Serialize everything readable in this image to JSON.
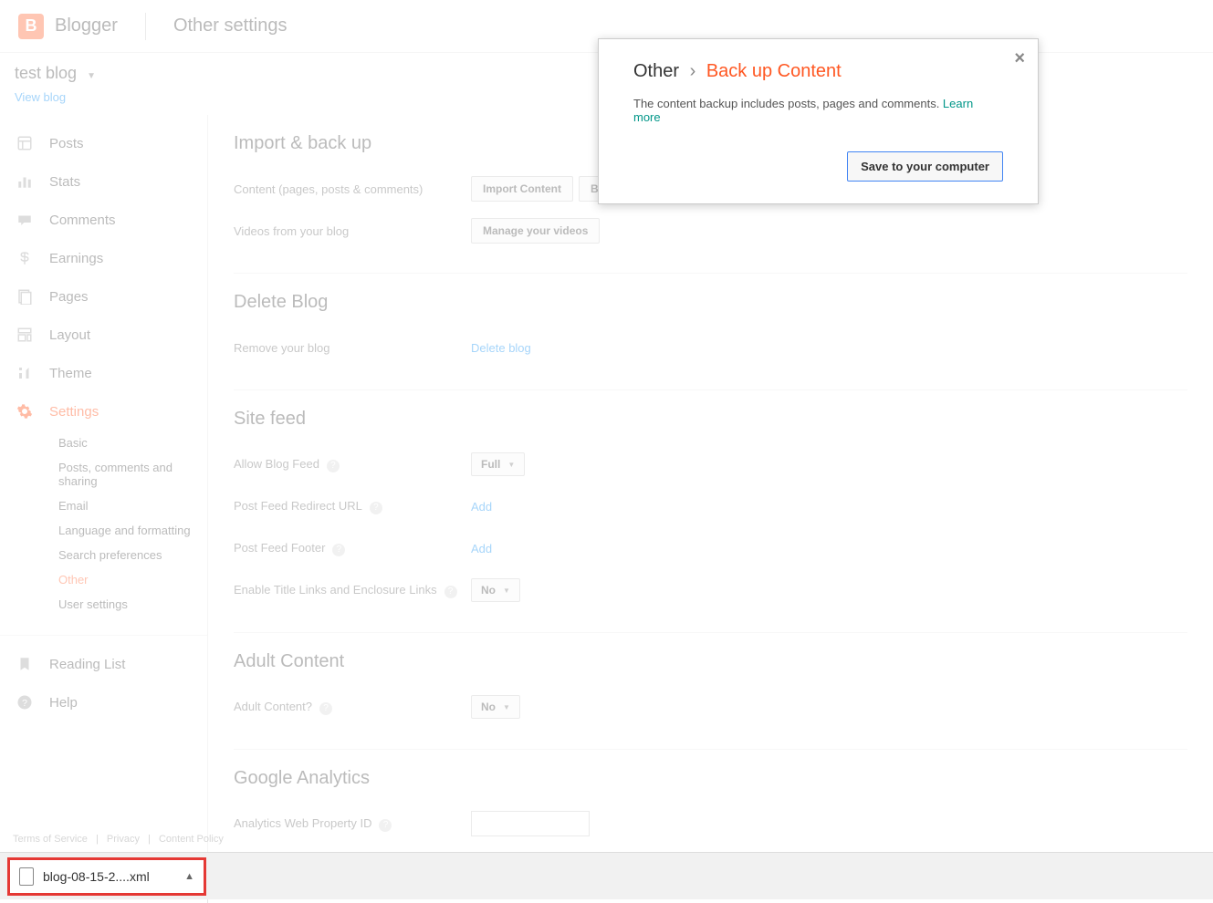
{
  "header": {
    "brand": "Blogger",
    "logo_letter": "B",
    "page_title": "Other settings"
  },
  "blog_selector": {
    "name": "test blog",
    "view_link": "View blog"
  },
  "nav": {
    "items": [
      {
        "label": "Posts",
        "icon": "posts"
      },
      {
        "label": "Stats",
        "icon": "stats"
      },
      {
        "label": "Comments",
        "icon": "comments"
      },
      {
        "label": "Earnings",
        "icon": "earnings"
      },
      {
        "label": "Pages",
        "icon": "pages"
      },
      {
        "label": "Layout",
        "icon": "layout"
      },
      {
        "label": "Theme",
        "icon": "theme"
      },
      {
        "label": "Settings",
        "icon": "settings",
        "active": true
      }
    ],
    "settings_sub": [
      "Basic",
      "Posts, comments and sharing",
      "Email",
      "Language and formatting",
      "Search preferences",
      "Other",
      "User settings"
    ],
    "bottom": [
      {
        "label": "Reading List",
        "icon": "bookmark"
      },
      {
        "label": "Help",
        "icon": "help"
      }
    ]
  },
  "sections": {
    "import": {
      "title": "Import & back up",
      "content_label": "Content (pages, posts & comments)",
      "import_btn": "Import Content",
      "backup_btn": "Back up Content",
      "videos_label": "Videos from your blog",
      "manage_videos_btn": "Manage your videos"
    },
    "delete": {
      "title": "Delete Blog",
      "remove_label": "Remove your blog",
      "delete_link": "Delete blog"
    },
    "feed": {
      "title": "Site feed",
      "allow_label": "Allow Blog Feed",
      "allow_value": "Full",
      "redirect_label": "Post Feed Redirect URL",
      "redirect_link": "Add",
      "footer_label": "Post Feed Footer",
      "footer_link": "Add",
      "enclosure_label": "Enable Title Links and Enclosure Links",
      "enclosure_value": "No"
    },
    "adult": {
      "title": "Adult Content",
      "label": "Adult Content?",
      "value": "No"
    },
    "analytics": {
      "title": "Google Analytics",
      "label": "Analytics Web Property ID"
    }
  },
  "modal": {
    "crumb_other": "Other",
    "crumb_sep": "›",
    "crumb_current": "Back up Content",
    "description": "The content backup includes posts, pages and comments. ",
    "learn_more": "Learn more",
    "save_btn": "Save to your computer"
  },
  "footer": {
    "terms": "Terms of Service",
    "privacy": "Privacy",
    "content_policy": "Content Policy"
  },
  "download": {
    "filename": "blog-08-15-2....xml"
  }
}
